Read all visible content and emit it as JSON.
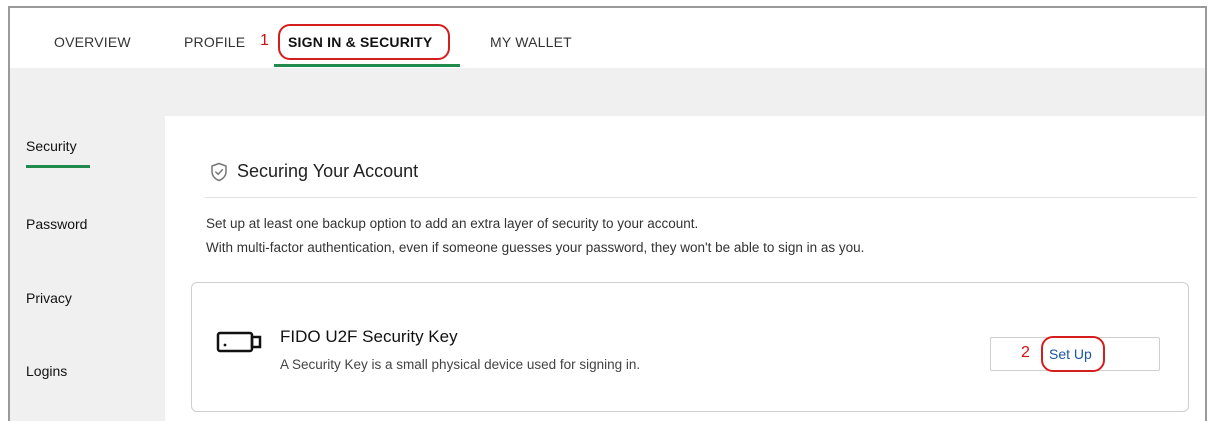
{
  "tabs": [
    {
      "label": "OVERVIEW"
    },
    {
      "label": "PROFILE"
    },
    {
      "label": "SIGN IN & SECURITY"
    },
    {
      "label": "MY WALLET"
    }
  ],
  "active_tab": "SIGN IN & SECURITY",
  "sidenav": {
    "items": [
      {
        "label": "Security"
      },
      {
        "label": "Password"
      },
      {
        "label": "Privacy"
      },
      {
        "label": "Logins"
      }
    ],
    "active": "Security"
  },
  "section": {
    "title": "Securing Your Account",
    "icon": "shield-check-icon",
    "desc_line1": "Set up at least one backup option to add an extra layer of security to your account.",
    "desc_line2": "With multi-factor authentication, even if someone guesses your password, they won't be able to sign in as you."
  },
  "option": {
    "icon": "security-key-icon",
    "title": "FIDO U2F Security Key",
    "subtitle": "A Security Key is a small physical device used for signing in.",
    "button_label": "Set Up"
  },
  "annotations": {
    "step1": "1",
    "step2": "2"
  },
  "colors": {
    "accent_green": "#1f8a4c",
    "link_blue": "#1a56a6",
    "annotation_red": "#d41d1d",
    "band_grey": "#f0f0f0"
  }
}
